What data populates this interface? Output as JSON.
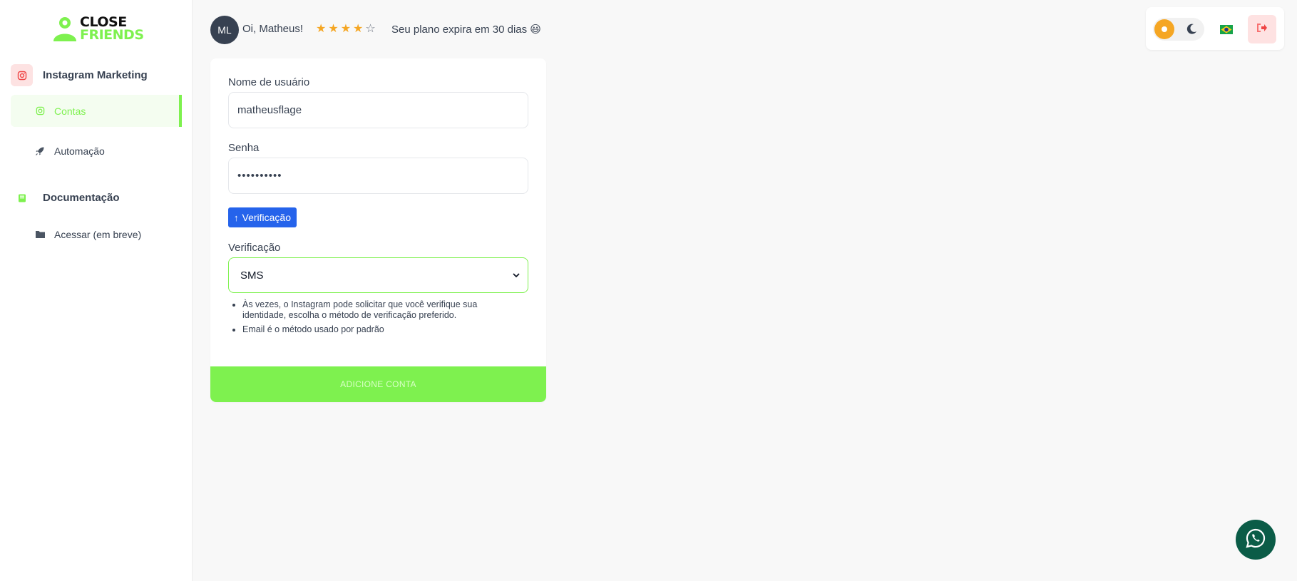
{
  "sidebar": {
    "logo": {
      "line1": "CLOSE",
      "line2": "FRIENDS"
    },
    "sections": [
      {
        "label": "Instagram Marketing",
        "icon": "instagram-icon"
      },
      {
        "label": "Documentação",
        "icon": "book-icon"
      }
    ],
    "items": [
      {
        "label": "Contas",
        "icon": "instagram-icon",
        "active": true
      },
      {
        "label": "Automação",
        "icon": "rocket-icon",
        "active": false
      },
      {
        "label": "Acessar (em breve)",
        "icon": "folder-icon",
        "active": false
      }
    ]
  },
  "header": {
    "avatar_initials": "ML",
    "greeting": "Oi, Matheus!",
    "rating": {
      "value": 4,
      "max": 5
    },
    "plan_notice": "Seu plano expira em 30 dias 😃"
  },
  "form": {
    "username_label": "Nome de usuário",
    "username_value": "matheusflage",
    "password_label": "Senha",
    "password_value": "••••••••••",
    "verify_button": "Verificação",
    "verification_label": "Verificação",
    "verification_selected": "SMS",
    "help": [
      "Às vezes, o Instagram pode solicitar que você verifique sua identidade, escolha o método de verificação preferido.",
      "Email é o método usado por padrão"
    ],
    "submit_label": "ADICIONE CONTA"
  },
  "colors": {
    "accent": "#7ef14f",
    "blue": "#2563eb",
    "star": "#f5a623",
    "whatsapp": "#0b5c47",
    "danger": "#ef4444"
  }
}
